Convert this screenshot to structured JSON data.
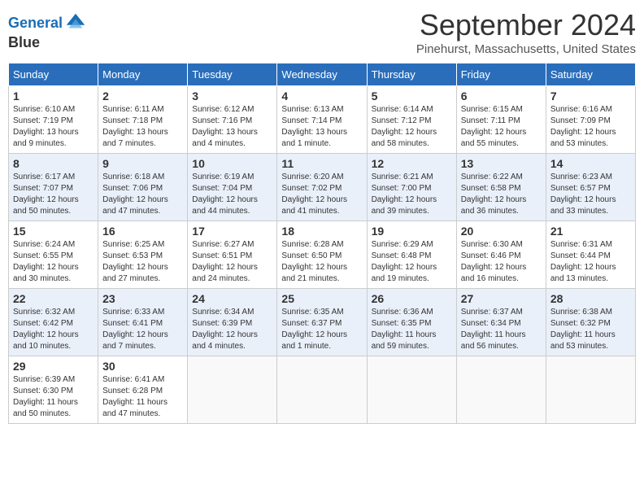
{
  "header": {
    "logo_line1": "General",
    "logo_line2": "Blue",
    "month": "September 2024",
    "location": "Pinehurst, Massachusetts, United States"
  },
  "weekdays": [
    "Sunday",
    "Monday",
    "Tuesday",
    "Wednesday",
    "Thursday",
    "Friday",
    "Saturday"
  ],
  "weeks": [
    [
      {
        "day": "1",
        "info": "Sunrise: 6:10 AM\nSunset: 7:19 PM\nDaylight: 13 hours and 9 minutes."
      },
      {
        "day": "2",
        "info": "Sunrise: 6:11 AM\nSunset: 7:18 PM\nDaylight: 13 hours and 7 minutes."
      },
      {
        "day": "3",
        "info": "Sunrise: 6:12 AM\nSunset: 7:16 PM\nDaylight: 13 hours and 4 minutes."
      },
      {
        "day": "4",
        "info": "Sunrise: 6:13 AM\nSunset: 7:14 PM\nDaylight: 13 hours and 1 minute."
      },
      {
        "day": "5",
        "info": "Sunrise: 6:14 AM\nSunset: 7:12 PM\nDaylight: 12 hours and 58 minutes."
      },
      {
        "day": "6",
        "info": "Sunrise: 6:15 AM\nSunset: 7:11 PM\nDaylight: 12 hours and 55 minutes."
      },
      {
        "day": "7",
        "info": "Sunrise: 6:16 AM\nSunset: 7:09 PM\nDaylight: 12 hours and 53 minutes."
      }
    ],
    [
      {
        "day": "8",
        "info": "Sunrise: 6:17 AM\nSunset: 7:07 PM\nDaylight: 12 hours and 50 minutes."
      },
      {
        "day": "9",
        "info": "Sunrise: 6:18 AM\nSunset: 7:06 PM\nDaylight: 12 hours and 47 minutes."
      },
      {
        "day": "10",
        "info": "Sunrise: 6:19 AM\nSunset: 7:04 PM\nDaylight: 12 hours and 44 minutes."
      },
      {
        "day": "11",
        "info": "Sunrise: 6:20 AM\nSunset: 7:02 PM\nDaylight: 12 hours and 41 minutes."
      },
      {
        "day": "12",
        "info": "Sunrise: 6:21 AM\nSunset: 7:00 PM\nDaylight: 12 hours and 39 minutes."
      },
      {
        "day": "13",
        "info": "Sunrise: 6:22 AM\nSunset: 6:58 PM\nDaylight: 12 hours and 36 minutes."
      },
      {
        "day": "14",
        "info": "Sunrise: 6:23 AM\nSunset: 6:57 PM\nDaylight: 12 hours and 33 minutes."
      }
    ],
    [
      {
        "day": "15",
        "info": "Sunrise: 6:24 AM\nSunset: 6:55 PM\nDaylight: 12 hours and 30 minutes."
      },
      {
        "day": "16",
        "info": "Sunrise: 6:25 AM\nSunset: 6:53 PM\nDaylight: 12 hours and 27 minutes."
      },
      {
        "day": "17",
        "info": "Sunrise: 6:27 AM\nSunset: 6:51 PM\nDaylight: 12 hours and 24 minutes."
      },
      {
        "day": "18",
        "info": "Sunrise: 6:28 AM\nSunset: 6:50 PM\nDaylight: 12 hours and 21 minutes."
      },
      {
        "day": "19",
        "info": "Sunrise: 6:29 AM\nSunset: 6:48 PM\nDaylight: 12 hours and 19 minutes."
      },
      {
        "day": "20",
        "info": "Sunrise: 6:30 AM\nSunset: 6:46 PM\nDaylight: 12 hours and 16 minutes."
      },
      {
        "day": "21",
        "info": "Sunrise: 6:31 AM\nSunset: 6:44 PM\nDaylight: 12 hours and 13 minutes."
      }
    ],
    [
      {
        "day": "22",
        "info": "Sunrise: 6:32 AM\nSunset: 6:42 PM\nDaylight: 12 hours and 10 minutes."
      },
      {
        "day": "23",
        "info": "Sunrise: 6:33 AM\nSunset: 6:41 PM\nDaylight: 12 hours and 7 minutes."
      },
      {
        "day": "24",
        "info": "Sunrise: 6:34 AM\nSunset: 6:39 PM\nDaylight: 12 hours and 4 minutes."
      },
      {
        "day": "25",
        "info": "Sunrise: 6:35 AM\nSunset: 6:37 PM\nDaylight: 12 hours and 1 minute."
      },
      {
        "day": "26",
        "info": "Sunrise: 6:36 AM\nSunset: 6:35 PM\nDaylight: 11 hours and 59 minutes."
      },
      {
        "day": "27",
        "info": "Sunrise: 6:37 AM\nSunset: 6:34 PM\nDaylight: 11 hours and 56 minutes."
      },
      {
        "day": "28",
        "info": "Sunrise: 6:38 AM\nSunset: 6:32 PM\nDaylight: 11 hours and 53 minutes."
      }
    ],
    [
      {
        "day": "29",
        "info": "Sunrise: 6:39 AM\nSunset: 6:30 PM\nDaylight: 11 hours and 50 minutes."
      },
      {
        "day": "30",
        "info": "Sunrise: 6:41 AM\nSunset: 6:28 PM\nDaylight: 11 hours and 47 minutes."
      },
      {
        "day": "",
        "info": ""
      },
      {
        "day": "",
        "info": ""
      },
      {
        "day": "",
        "info": ""
      },
      {
        "day": "",
        "info": ""
      },
      {
        "day": "",
        "info": ""
      }
    ]
  ]
}
